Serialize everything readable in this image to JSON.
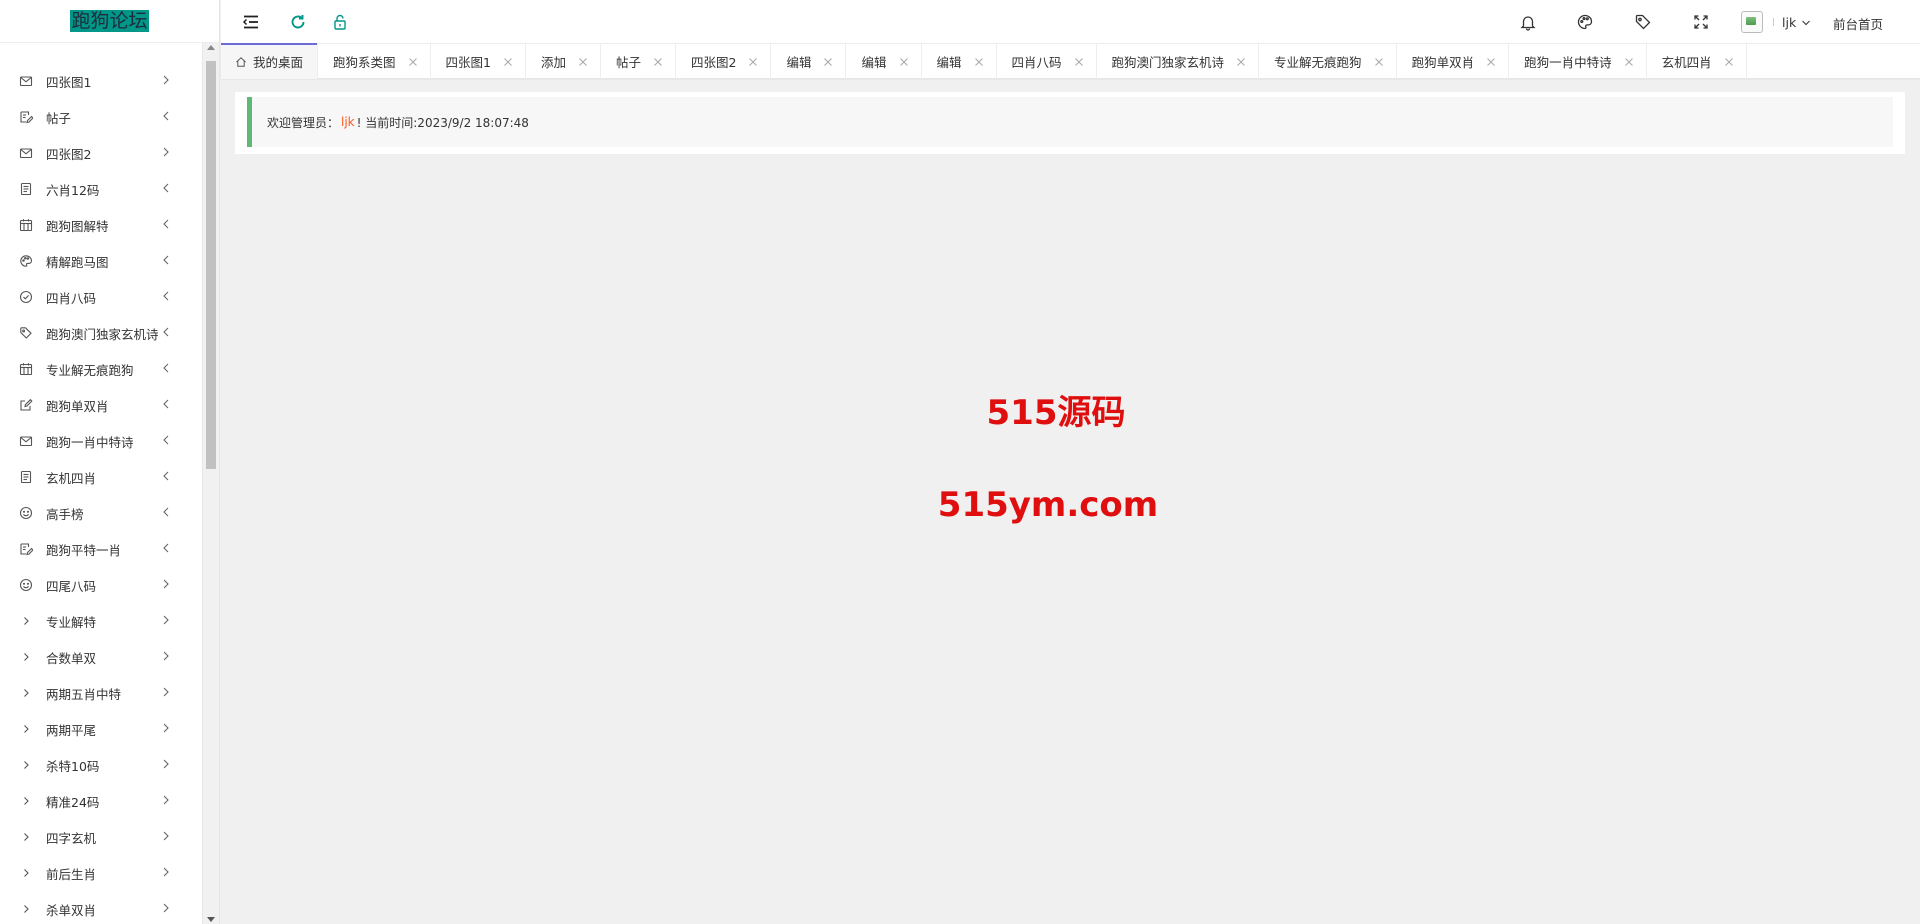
{
  "logo": {
    "text": "跑狗论坛"
  },
  "sidebar": {
    "items": [
      {
        "label": "四张图1",
        "icon": "mail-icon",
        "arrow": "right"
      },
      {
        "label": "帖子",
        "icon": "edit-note-icon",
        "arrow": "left"
      },
      {
        "label": "四张图2",
        "icon": "mail-icon",
        "arrow": "right"
      },
      {
        "label": "六肖12码",
        "icon": "note-icon",
        "arrow": "left"
      },
      {
        "label": "跑狗图解特",
        "icon": "calendar-icon",
        "arrow": "left"
      },
      {
        "label": "精解跑马图",
        "icon": "palette-icon",
        "arrow": "left"
      },
      {
        "label": "四肖八码",
        "icon": "check-circle-icon",
        "arrow": "left"
      },
      {
        "label": "跑狗澳门独家玄机诗",
        "icon": "tag-icon",
        "arrow": "left"
      },
      {
        "label": "专业解无痕跑狗",
        "icon": "calendar-icon",
        "arrow": "left"
      },
      {
        "label": "跑狗单双肖",
        "icon": "edit-icon",
        "arrow": "left"
      },
      {
        "label": "跑狗一肖中特诗",
        "icon": "mail-icon",
        "arrow": "left"
      },
      {
        "label": "玄机四肖",
        "icon": "note-icon",
        "arrow": "left"
      },
      {
        "label": "高手榜",
        "icon": "smile-icon",
        "arrow": "left"
      },
      {
        "label": "跑狗平特一肖",
        "icon": "edit-note-icon",
        "arrow": "left"
      },
      {
        "label": "四尾八码",
        "icon": "smile-icon",
        "arrow": "right"
      },
      {
        "label": "专业解特",
        "icon": "chevron-right-icon",
        "arrow": "right"
      },
      {
        "label": "合数单双",
        "icon": "chevron-right-icon",
        "arrow": "right"
      },
      {
        "label": "两期五肖中特",
        "icon": "chevron-right-icon",
        "arrow": "right"
      },
      {
        "label": "两期平尾",
        "icon": "chevron-right-icon",
        "arrow": "right"
      },
      {
        "label": "杀特10码",
        "icon": "chevron-right-icon",
        "arrow": "right"
      },
      {
        "label": "精准24码",
        "icon": "chevron-right-icon",
        "arrow": "right"
      },
      {
        "label": "四字玄机",
        "icon": "chevron-right-icon",
        "arrow": "right"
      },
      {
        "label": "前后生肖",
        "icon": "chevron-right-icon",
        "arrow": "right"
      },
      {
        "label": "杀单双肖",
        "icon": "chevron-right-icon",
        "arrow": "right"
      }
    ]
  },
  "header": {
    "icons": [
      "menu-fold-icon",
      "refresh-icon",
      "unlock-icon",
      "bell-icon",
      "theme-icon",
      "tag-icon",
      "fullscreen-icon"
    ],
    "user_name": "ljk",
    "front_link": "前台首页",
    "accent": "#009688"
  },
  "tabs": {
    "home": "我的桌面",
    "items": [
      "跑狗系类图",
      "四张图1",
      "添加",
      "帖子",
      "四张图2",
      "编辑",
      "编辑",
      "编辑",
      "四肖八码",
      "跑狗澳门独家玄机诗",
      "专业解无痕跑狗",
      "跑狗单双肖",
      "跑狗一肖中特诗",
      "玄机四肖"
    ]
  },
  "welcome": {
    "prefix": "欢迎管理员：",
    "name": "ljk",
    "suffix": "! 当前时间:2023/9/2 18:07:48"
  },
  "watermark": {
    "line1": "515源码",
    "line2": "515ym.com",
    "color": "#e00f0f"
  }
}
